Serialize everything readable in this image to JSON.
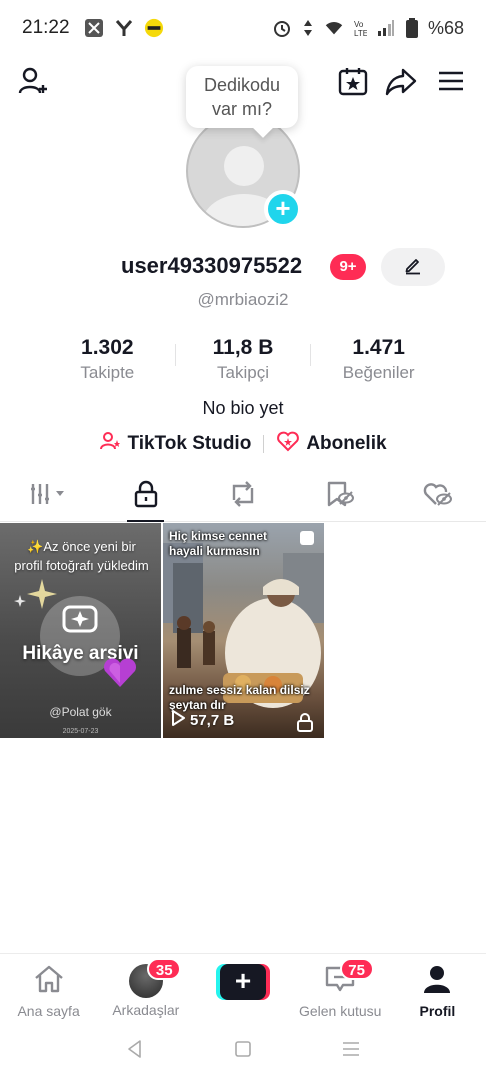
{
  "status_bar": {
    "time": "21:22",
    "battery": "%68",
    "icons": [
      "scissors-app-icon",
      "y-app-icon",
      "yellow-app-icon",
      "alarm-icon",
      "data-arrows-icon",
      "wifi-icon",
      "volte-icon",
      "signal-icon",
      "battery-icon"
    ]
  },
  "top_bar": {
    "icons": [
      "add-friend-icon",
      "calendar-star-icon",
      "share-icon",
      "menu-icon"
    ]
  },
  "bubble": {
    "line1": "Dedikodu",
    "line2": "var mı?"
  },
  "profile": {
    "username": "user49330975522",
    "notification_badge": "9+",
    "handle": "@mrbiaozi2",
    "bio": "No bio yet"
  },
  "stats": [
    {
      "value": "1.302",
      "label": "Takipte"
    },
    {
      "value": "11,8 B",
      "label": "Takipçi"
    },
    {
      "value": "1.471",
      "label": "Beğeniler"
    }
  ],
  "links": {
    "studio": "TikTok Studio",
    "subscription": "Abonelik"
  },
  "tabs": [
    "grid-filter-icon",
    "lock-icon",
    "repost-icon",
    "favorites-icon",
    "liked-icon"
  ],
  "videos": [
    {
      "top_text": "✨Az önce yeni bir profil fotoğrafı yükledim",
      "label": "Hikâye arşivi",
      "author": "@Polat gök",
      "date": "2025-07-23"
    },
    {
      "caption_top": "Hiç kimse cennet hayali kurmasın",
      "caption_bottom": "zulme sessiz kalan dilsiz şeytan dır",
      "views": "57,7 B"
    }
  ],
  "bottom_nav": {
    "home": "Ana sayfa",
    "friends": "Arkadaşlar",
    "friends_badge": "35",
    "inbox": "Gelen kutusu",
    "inbox_badge": "75",
    "profile": "Profil",
    "create_symbol": "+"
  },
  "colors": {
    "accent_red": "#fe2c55",
    "accent_cyan": "#25f4ee",
    "plus_badge": "#20d5ec",
    "text_primary": "#161823",
    "text_secondary": "#8a8b91"
  }
}
